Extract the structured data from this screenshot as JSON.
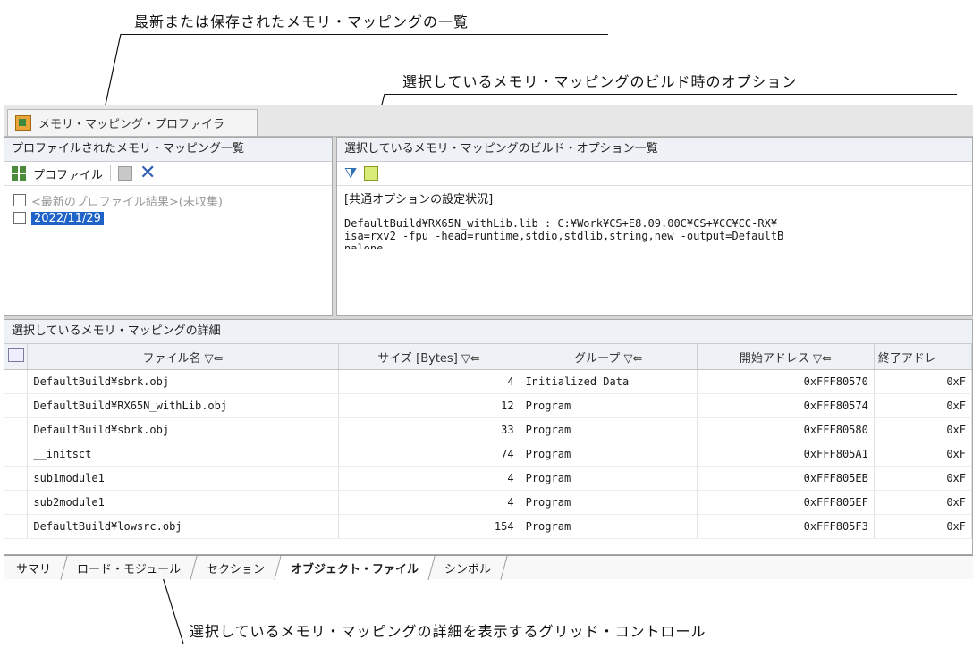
{
  "callouts": {
    "top": "最新または保存されたメモリ・マッピングの一覧",
    "options": "選択しているメモリ・マッピングのビルド時のオプション",
    "bottom": "選択しているメモリ・マッピングの詳細を表示するグリッド・コントロール"
  },
  "window": {
    "tab_title": "メモリ・マッピング・プロファイラ",
    "icon": "profiler-icon"
  },
  "left_pane": {
    "title": "プロファイルされたメモリ・マッピング一覧",
    "toolbar": {
      "profile_label": "プロファイル"
    },
    "items": [
      {
        "label": "<最新のプロファイル結果>(未収集)",
        "checked": false
      },
      {
        "label": "2022/11/29",
        "checked": false,
        "selected": true
      }
    ]
  },
  "right_pane": {
    "title": "選択しているメモリ・マッピングのビルド・オプション一覧",
    "heading": "[共通オプションの設定状況]",
    "line1": "DefaultBuild¥RX65N_withLib.lib : C:¥Work¥CS+E8.09.00C¥CS+¥CC¥CC-RX¥",
    "line2": "isa=rxv2 -fpu -head=runtime,stdio,stdlib,string,new -output=DefaultB",
    "line3": "nalone"
  },
  "detail": {
    "title": "選択しているメモリ・マッピングの詳細",
    "columns": [
      "ファイル名",
      "サイズ [Bytes]",
      "グループ",
      "開始アドレス",
      "終了アドレ"
    ],
    "rows": [
      [
        "DefaultBuild¥sbrk.obj",
        "4",
        "Initialized Data",
        "0xFFF80570",
        "0xF"
      ],
      [
        "DefaultBuild¥RX65N_withLib.obj",
        "12",
        "Program",
        "0xFFF80574",
        "0xF"
      ],
      [
        "DefaultBuild¥sbrk.obj",
        "33",
        "Program",
        "0xFFF80580",
        "0xF"
      ],
      [
        "__initsct",
        "74",
        "Program",
        "0xFFF805A1",
        "0xF"
      ],
      [
        "sub1module1",
        "4",
        "Program",
        "0xFFF805EB",
        "0xF"
      ],
      [
        "sub2module1",
        "4",
        "Program",
        "0xFFF805EF",
        "0xF"
      ],
      [
        "DefaultBuild¥lowsrc.obj",
        "154",
        "Program",
        "0xFFF805F3",
        "0xF"
      ]
    ]
  },
  "bottom_tabs": [
    "サマリ",
    "ロード・モジュール",
    "セクション",
    "オブジェクト・ファイル",
    "シンボル"
  ],
  "active_tab": "オブジェクト・ファイル"
}
